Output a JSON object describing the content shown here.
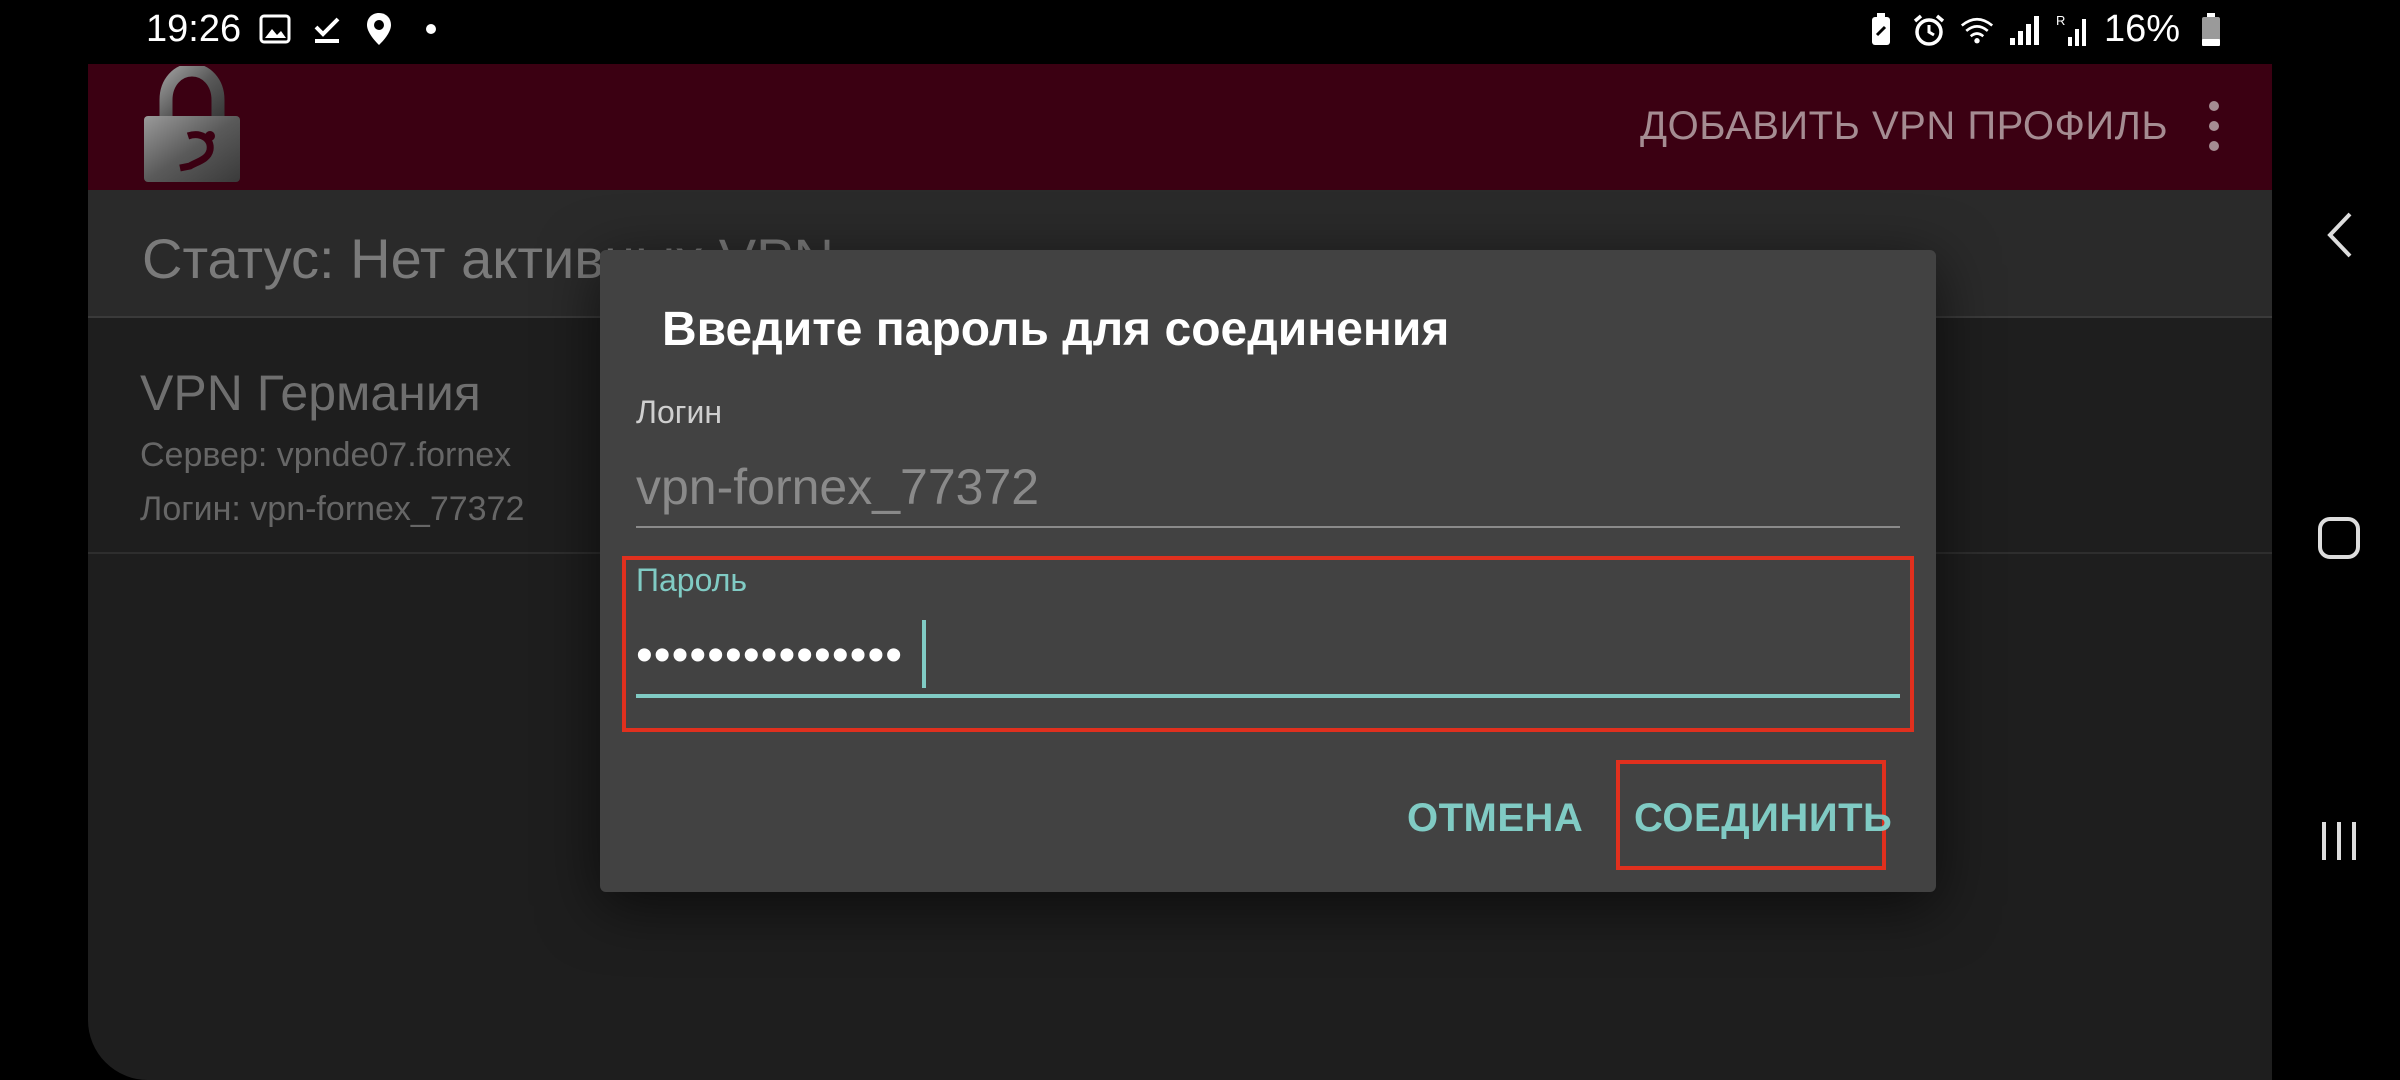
{
  "status_bar": {
    "time": "19:26",
    "battery": "16%",
    "left_icons": [
      "image-icon",
      "check-download-icon",
      "location-icon",
      "dot-icon"
    ],
    "right_icons": [
      "battery-saver-icon",
      "alarm-icon",
      "wifi-icon",
      "signal-icon",
      "roaming-signal-icon",
      "battery-icon"
    ]
  },
  "app_bar": {
    "action_label": "ДОБАВИТЬ VPN ПРОФИЛЬ"
  },
  "status_row": {
    "text": "Статус: Нет активных VPN"
  },
  "profile": {
    "name": "VPN Германия",
    "server": "Сервер: vpnde07.fornex",
    "login": "Логин: vpn-fornex_77372"
  },
  "dialog": {
    "title": "Введите пароль для соединения",
    "login_label": "Логин",
    "login_value": "vpn-fornex_77372",
    "password_label": "Пароль",
    "password_value": "•••••••••••••••",
    "cancel_label": "ОТМЕНА",
    "connect_label": "СОЕДИНИТЬ"
  },
  "colors": {
    "accent": "#80cbc4",
    "app_bar": "#3b0012",
    "highlight": "#e0301e",
    "dialog_bg": "#424242"
  }
}
